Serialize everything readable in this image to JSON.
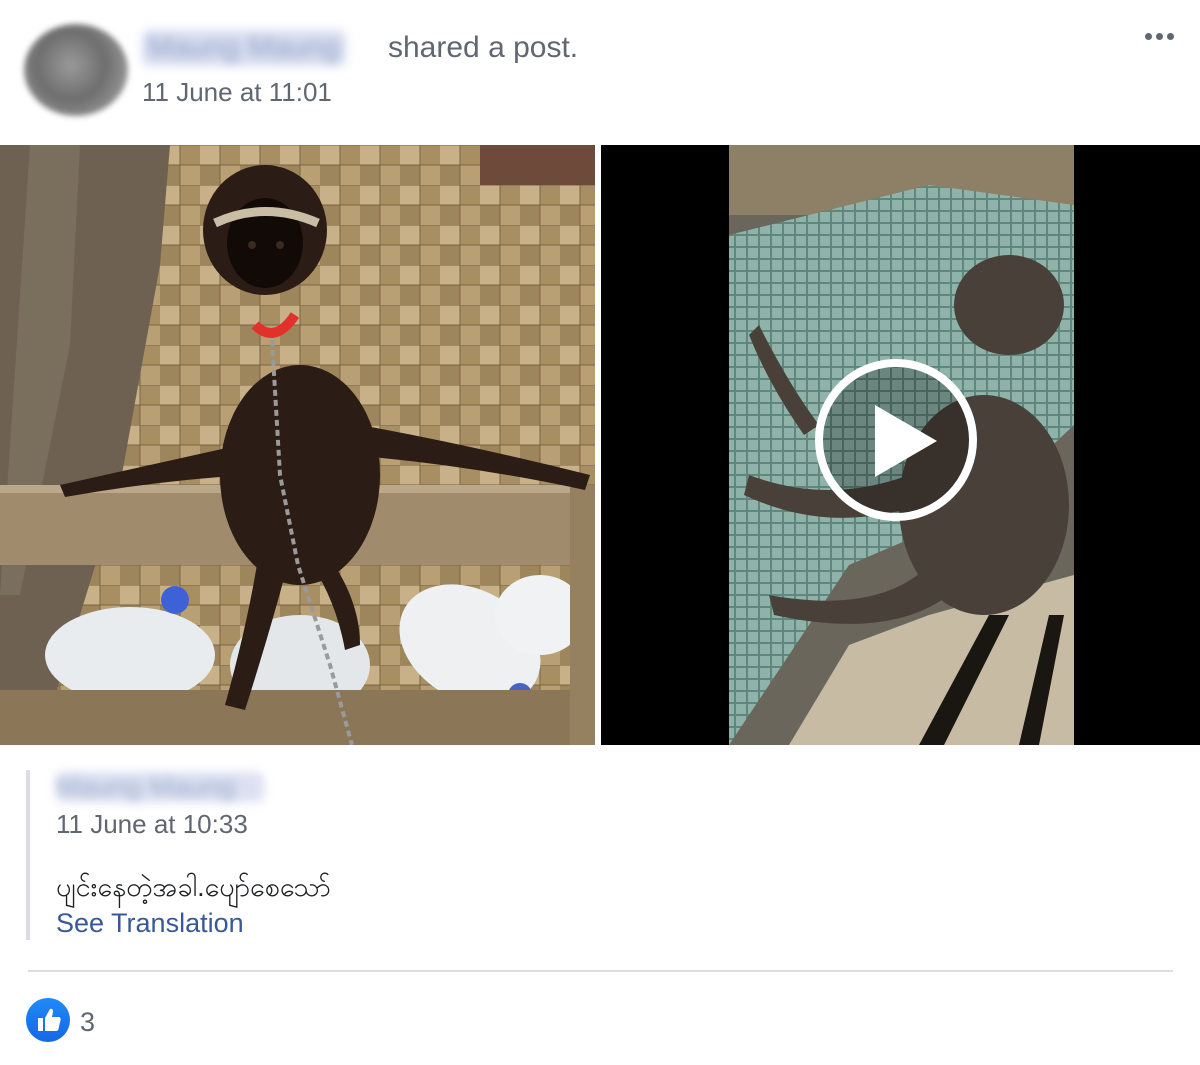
{
  "header": {
    "author": "Maung Maung",
    "action": "shared a post.",
    "timestamp": "11 June at 11:01"
  },
  "icons": {
    "menu": "more-options-icon",
    "play": "play-icon",
    "reaction": "like-icon"
  },
  "shared_post": {
    "author": "Maung Maung",
    "timestamp": "11 June at 10:33",
    "text": "ပျင်းနေတဲ့အခါ.ပျော်စေသော်",
    "translate_label": "See Translation"
  },
  "reactions": {
    "like_count": "3"
  },
  "colors": {
    "link": "#385898",
    "meta": "#606770",
    "like": "#1877f2"
  }
}
